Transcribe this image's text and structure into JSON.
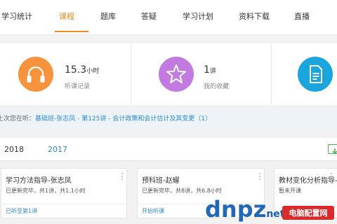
{
  "nav": {
    "items": [
      {
        "label": "学习统计",
        "active": false
      },
      {
        "label": "课程",
        "active": true
      },
      {
        "label": "题库",
        "active": false
      },
      {
        "label": "答疑",
        "active": false
      },
      {
        "label": "学习计划",
        "active": false
      },
      {
        "label": "资料下载",
        "active": false
      },
      {
        "label": "直播",
        "active": false
      }
    ]
  },
  "stats": [
    {
      "icon": "headphones-icon",
      "value": "15.3",
      "unit": "小时",
      "label": "听课记录",
      "color": "#f7933c"
    },
    {
      "icon": "star-icon",
      "value": "1",
      "unit": "讲",
      "label": "我的收藏",
      "color": "#c27ae0"
    },
    {
      "icon": "document-icon",
      "value": "",
      "unit": "",
      "label": "",
      "color": "#1aa6dd"
    }
  ],
  "last_viewed": {
    "prefix": "上次您在听：",
    "link": "基础班-张志凤 - 第125讲 - 会计政策和会计估计及其变更（1）"
  },
  "years": {
    "tabs": [
      "2018",
      "2017"
    ],
    "active": "2018"
  },
  "courses": [
    {
      "title": "学习方法指导-张志凤",
      "meta": "已更新完毕，共1讲，共1.1小时",
      "action": "已听至第1讲"
    },
    {
      "title": "预科班-赵耀",
      "meta": "已更新完毕，共8讲，共6.8小时",
      "action": "开始听课"
    },
    {
      "title": "教材变化分析指导-东",
      "meta": "暂未开课",
      "action": ""
    }
  ],
  "watermark": {
    "brand": "dnpz.net",
    "label": "电脑配置网"
  },
  "colors": {
    "accent": "#f08a24",
    "link": "#2a8ad6"
  }
}
